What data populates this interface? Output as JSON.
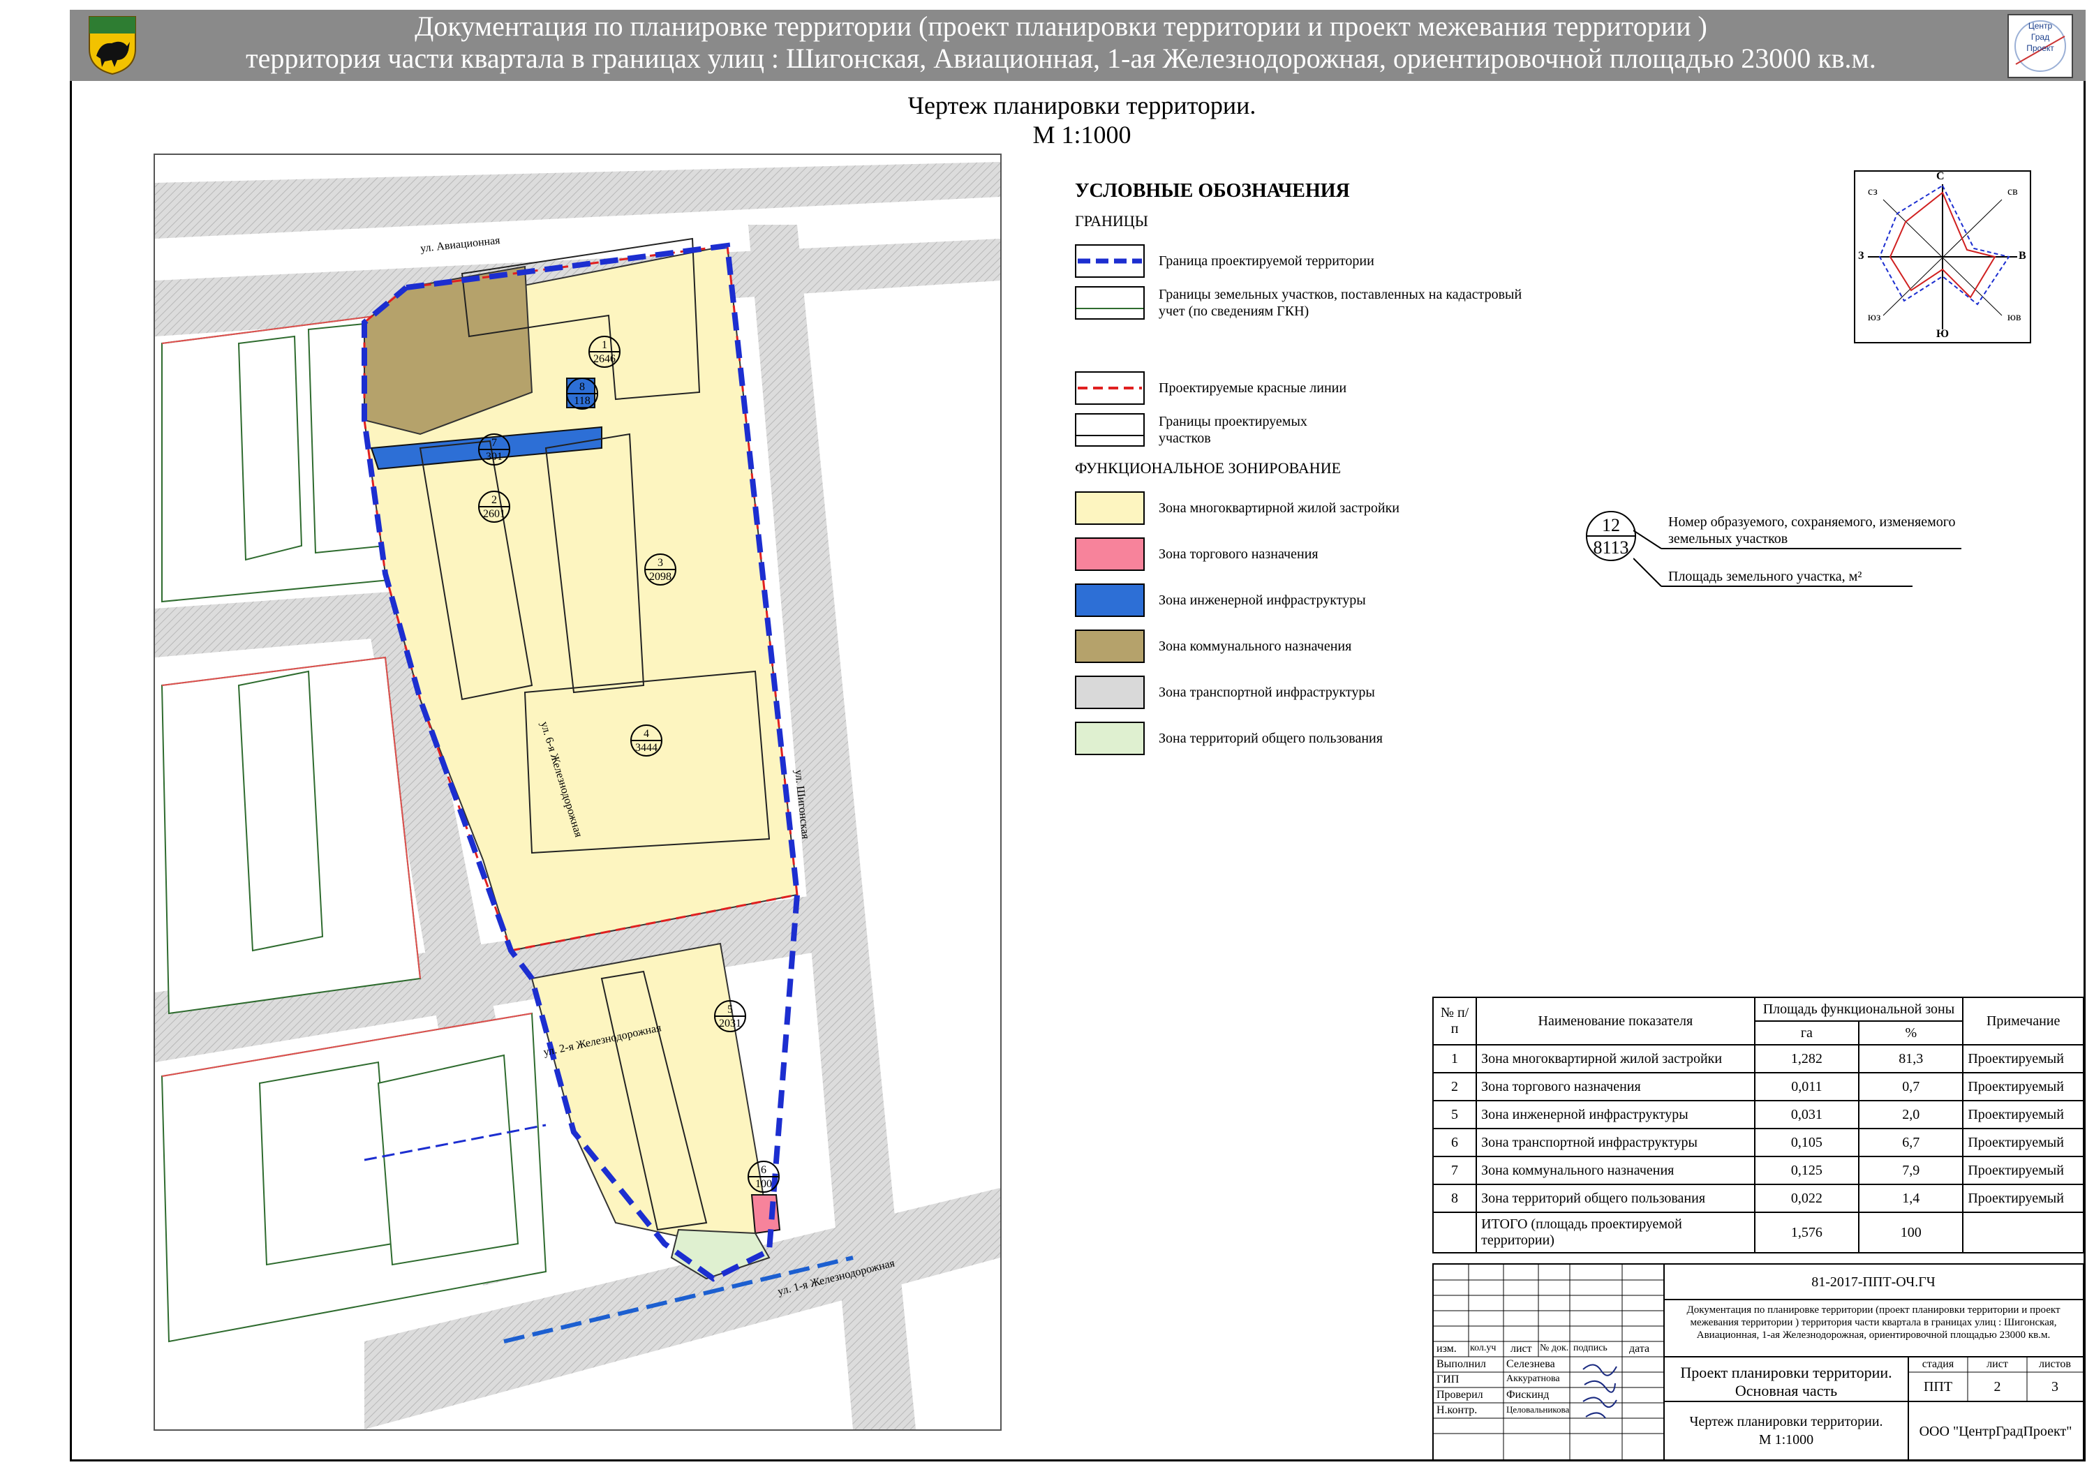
{
  "header": {
    "line1": "Документация по планировке территории (проект планировки территории и проект межевания территории )",
    "line2": "территория части квартала в границах улиц : Шигонская, Авиационная, 1-ая Железнодорожная, ориентировочной площадью 23000 кв.м.",
    "logo_lines": [
      "Центр",
      "Град",
      "Проект"
    ]
  },
  "sheet_title": {
    "line1": "Чертеж планировки территории.",
    "line2": "М 1:1000"
  },
  "streets": {
    "aviacionnaya": "ул. Авиационная",
    "shigonskaya": "ул. Шигонская",
    "zhd6": "ул. 6-я Железнодорожная",
    "zhd2": "ул. 2-я Железнодорожная",
    "zhd1": "ул. 1-я Железнодорожная"
  },
  "parcels": [
    {
      "num": "1",
      "area": "2646"
    },
    {
      "num": "8",
      "area": "118"
    },
    {
      "num": "7",
      "area": "301"
    },
    {
      "num": "2",
      "area": "2601"
    },
    {
      "num": "3",
      "area": "2098"
    },
    {
      "num": "4",
      "area": "3444"
    },
    {
      "num": "5",
      "area": "2031"
    },
    {
      "num": "6",
      "area": "100"
    }
  ],
  "legend": {
    "title": "УСЛОВНЫЕ ОБОЗНАЧЕНИЯ",
    "boundaries_heading": "ГРАНИЦЫ",
    "boundaries": [
      {
        "label": "Граница проектируемой территории"
      },
      {
        "label": "Границы земельных участков, поставленных на кадастровый учет (по сведениям ГКН)"
      },
      {
        "label": "Проектируемые красные линии"
      },
      {
        "label": "Границы проектируемых участков"
      }
    ],
    "zoning_heading": "ФУНКЦИОНАЛЬНОЕ ЗОНИРОВАНИЕ",
    "zones": [
      {
        "label": "Зона многоквартирной жилой застройки",
        "color": "#fdf5c0"
      },
      {
        "label": "Зона торгового назначения",
        "color": "#f7839b"
      },
      {
        "label": "Зона  инженерной инфраструктуры",
        "color": "#2d6fd6"
      },
      {
        "label": "Зона коммунального назначения",
        "color": "#b5a26b"
      },
      {
        "label": "Зона транспортной инфраструктуры",
        "color": "#d9d9d9"
      },
      {
        "label": "Зона территорий общего пользования",
        "color": "#dff0d0"
      }
    ],
    "parcel_key": {
      "num": "12",
      "area": "8113",
      "num_label": "Номер образуемого, сохраняемого, изменяемого земельных участков",
      "area_label": "Площадь земельного участка, м²"
    }
  },
  "compass": {
    "n": "С",
    "s": "Ю",
    "e": "В",
    "w": "З",
    "ne": "св",
    "nw": "сз",
    "se": "юв",
    "sw": "юз"
  },
  "indicators": {
    "headers": {
      "num": "№ п/п",
      "name": "Наименование показателя",
      "area": "Площадь функциональной зоны",
      "ha": "га",
      "pct": "%",
      "note": "Примечание"
    },
    "rows": [
      {
        "num": "1",
        "name": "Зона многоквартирной жилой застройки",
        "ha": "1,282",
        "pct": "81,3",
        "note": "Проектируемый"
      },
      {
        "num": "2",
        "name": "Зона торгового назначения",
        "ha": "0,011",
        "pct": "0,7",
        "note": "Проектируемый"
      },
      {
        "num": "5",
        "name": "Зона инженерной инфраструктуры",
        "ha": "0,031",
        "pct": "2,0",
        "note": "Проектируемый"
      },
      {
        "num": "6",
        "name": "Зона транспортной инфраструктуры",
        "ha": "0,105",
        "pct": "6,7",
        "note": "Проектируемый"
      },
      {
        "num": "7",
        "name": "Зона коммунального назначения",
        "ha": "0,125",
        "pct": "7,9",
        "note": "Проектируемый"
      },
      {
        "num": "8",
        "name": "Зона территорий общего пользования",
        "ha": "0,022",
        "pct": "1,4",
        "note": "Проектируемый"
      }
    ],
    "total": {
      "name": "ИТОГО (площадь проектируемой территории)",
      "ha": "1,576",
      "pct": "100"
    }
  },
  "stamp": {
    "code": "81-2017-ППТ-ОЧ.ГЧ",
    "description": "Документация по планировке территории (проект планировки территории и проект межевания территории ) территория части квартала в границах улиц : Шигонская, Авиационная, 1-ая Железнодорожная, ориентировочной площадью 23000 кв.м.",
    "cols": [
      "изм.",
      "кол.уч",
      "лист",
      "№ док.",
      "подпись",
      "дата"
    ],
    "roles": [
      {
        "role": "Выполнил",
        "name": "Селезнева"
      },
      {
        "role": "ГИП",
        "name": "Аккуратнова"
      },
      {
        "role": "Проверил",
        "name": "Фискинд"
      },
      {
        "role": "Н.контр.",
        "name": "Целовальникова"
      }
    ],
    "project_name_1": "Проект планировки территории.",
    "project_name_2": "Основная часть",
    "stage_label": "стадия",
    "sheet_label": "лист",
    "sheets_label": "листов",
    "stage": "ППТ",
    "sheet": "2",
    "sheets": "3",
    "drawing_name_1": "Чертеж планировки территории.",
    "drawing_name_2": "М 1:1000",
    "company": "ООО \"ЦентрГрадПроект\""
  }
}
